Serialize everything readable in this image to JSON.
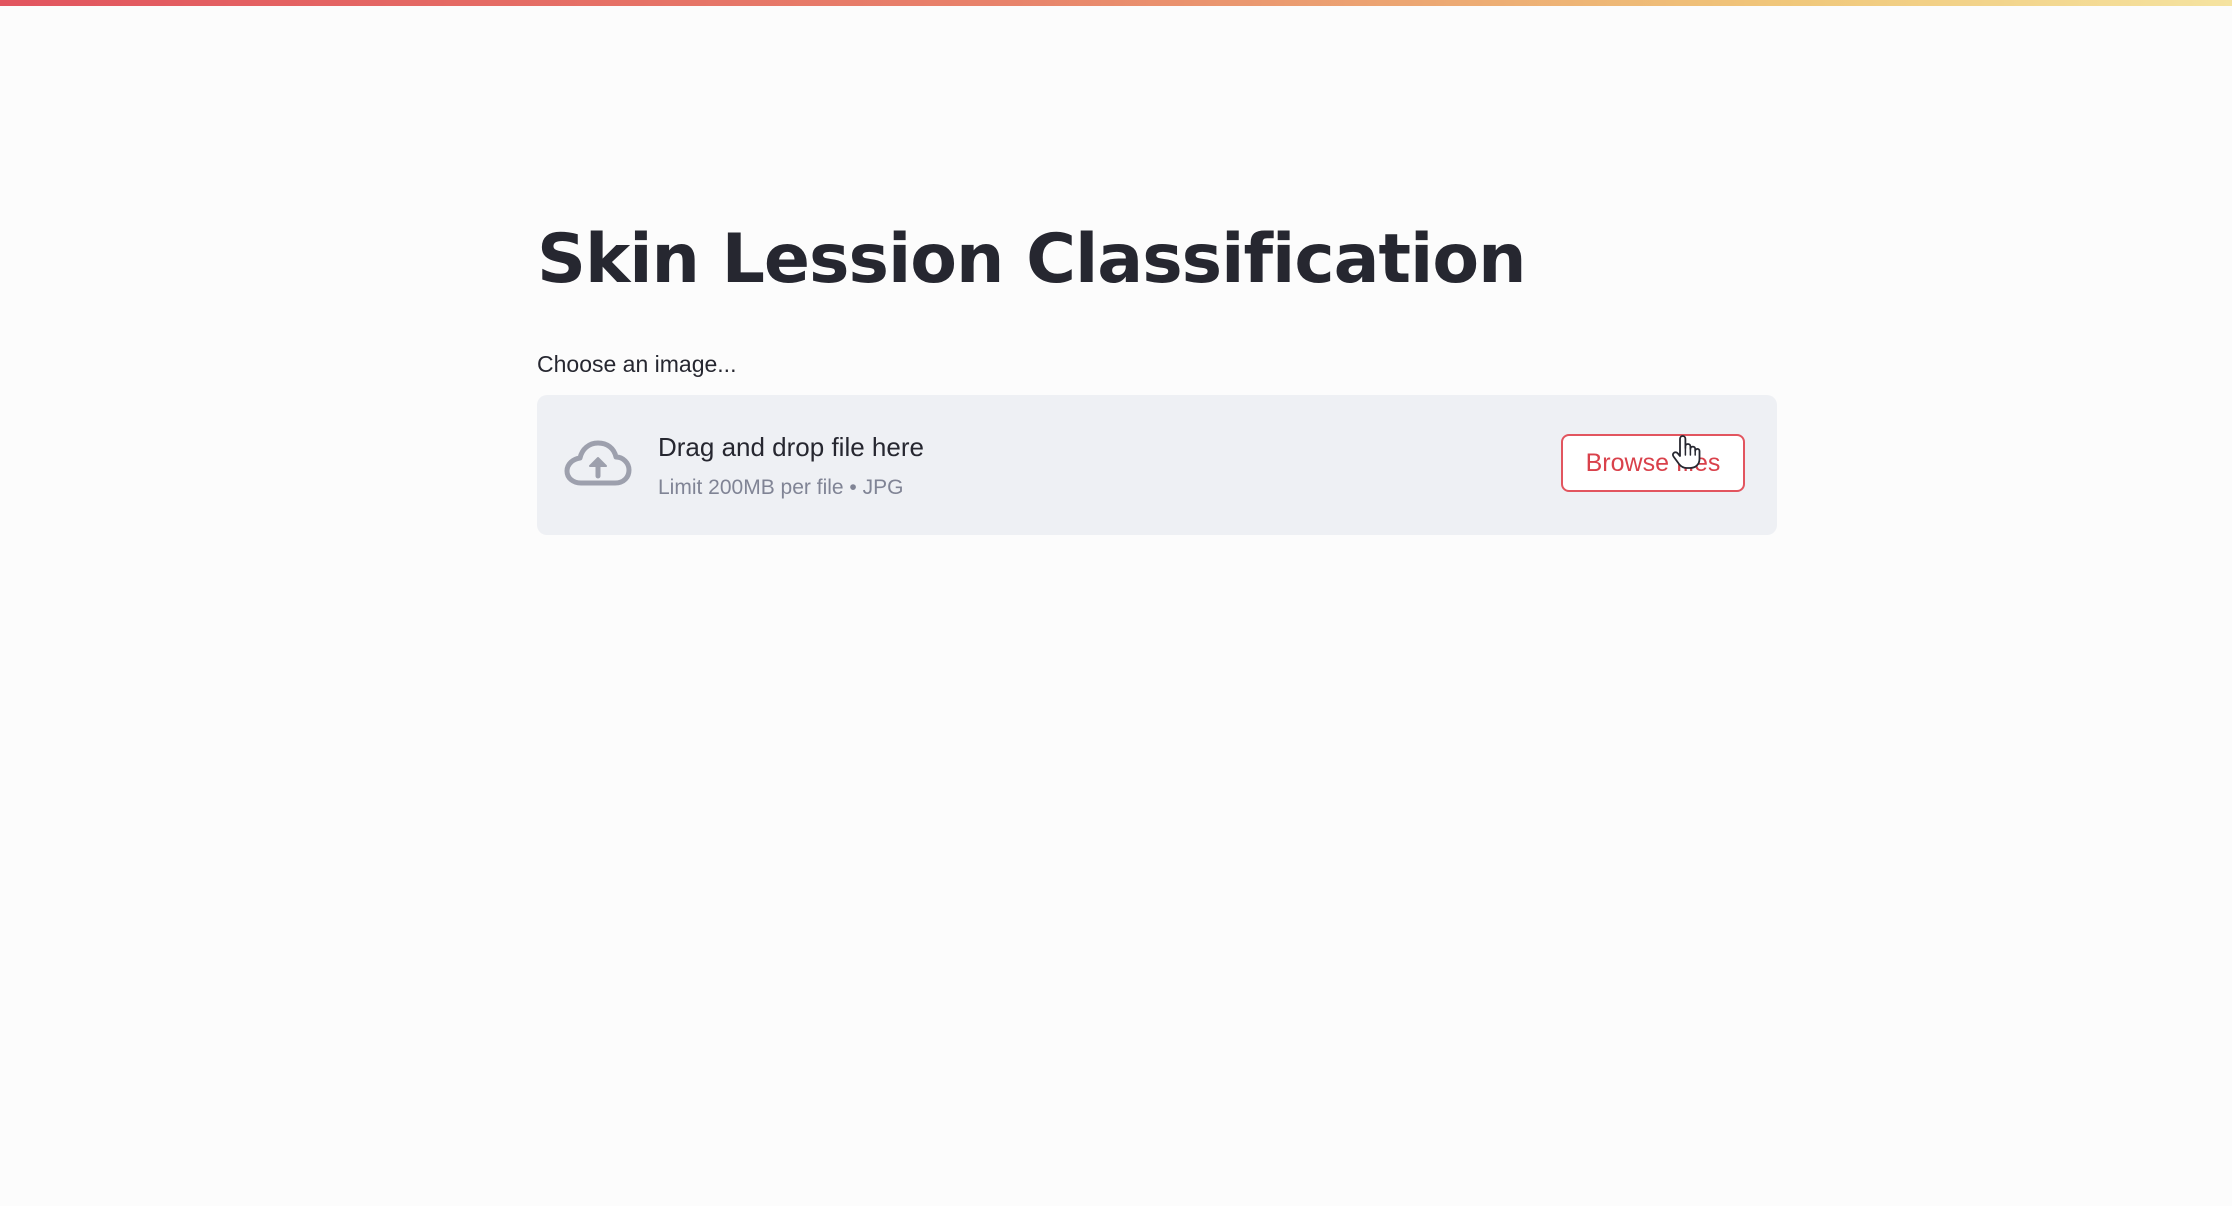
{
  "app": {
    "title": "Skin Lession Classification"
  },
  "uploader": {
    "label": "Choose an image...",
    "drop_title": "Drag and drop file here",
    "drop_limit": "Limit 200MB per file • JPG",
    "browse_label": "Browse files",
    "icon": "cloud-upload-icon"
  },
  "cursor": {
    "icon": "hand-pointer-icon"
  },
  "colors": {
    "accent": "#e2555f",
    "text": "#262730",
    "muted_text": "#808495",
    "dropzone_bg": "#eef0f4",
    "page_bg": "#fcfcfc"
  }
}
